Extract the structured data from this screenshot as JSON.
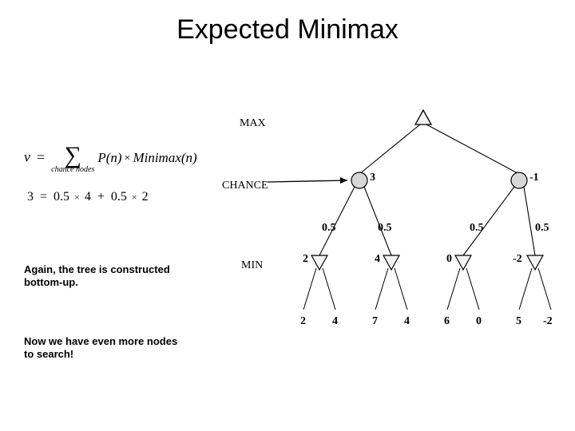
{
  "title": "Expected Minimax",
  "formula": {
    "lhs": "v",
    "eq": "=",
    "sigma": "∑",
    "sigma_sub": "chance nodes",
    "prob": "P(n)",
    "times": "×",
    "mm": "Minimax(n)"
  },
  "calc": {
    "lhs": "3",
    "eq": "=",
    "t1a": "0.5",
    "times1": "×",
    "t1b": "4",
    "plus": "+",
    "t2a": "0.5",
    "times2": "×",
    "t2b": "2"
  },
  "notes": {
    "line1a": "Again, the tree is constructed",
    "line1b": "bottom-up.",
    "line2a": "Now we have even more nodes",
    "line2b": "to search!"
  },
  "layers": {
    "max": "MAX",
    "chance": "CHANCE",
    "min": "MIN"
  },
  "chart_data": {
    "type": "tree",
    "max_node": {
      "value": null
    },
    "chance_nodes": [
      {
        "value": 3,
        "probs": [
          0.5,
          0.5
        ]
      },
      {
        "value": -1,
        "probs": [
          0.5,
          0.5
        ]
      }
    ],
    "min_nodes": [
      {
        "value": 2,
        "leaves": [
          2,
          4
        ]
      },
      {
        "value": 4,
        "leaves": [
          7,
          4
        ]
      },
      {
        "value": 0,
        "leaves": [
          6,
          0
        ]
      },
      {
        "value": -2,
        "leaves": [
          5,
          -2
        ]
      }
    ],
    "probs_labels": [
      "0.5",
      "0.5",
      "0.5",
      "0.5"
    ],
    "min_labels": [
      "2",
      "4",
      "0",
      "-2"
    ],
    "leaf_labels": [
      "2",
      "4",
      "7",
      "4",
      "6",
      "0",
      "5",
      "-2"
    ],
    "chance_labels": [
      "3",
      "-1"
    ]
  }
}
